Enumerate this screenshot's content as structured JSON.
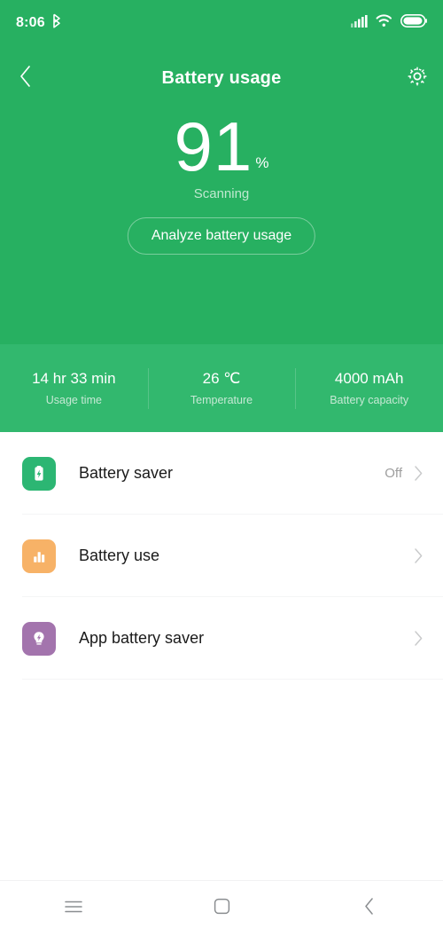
{
  "status_bar": {
    "time": "8:06",
    "icons": [
      "bluetooth-icon",
      "signal-icon",
      "wifi-icon",
      "battery-icon"
    ]
  },
  "header": {
    "title": "Battery usage",
    "back_icon": "chevron-left-icon",
    "settings_icon": "gear-icon"
  },
  "hero": {
    "percent": "91",
    "percent_symbol": "%",
    "status": "Scanning",
    "analyze_label": "Analyze battery usage",
    "bg_color": "#27b061"
  },
  "stats": {
    "bg_color": "#32b86e",
    "items": [
      {
        "value": "14 hr 33 min",
        "label": "Usage time"
      },
      {
        "value": "26 ℃",
        "label": "Temperature"
      },
      {
        "value": "4000 mAh",
        "label": "Battery capacity"
      }
    ]
  },
  "list": {
    "rows": [
      {
        "label": "Battery saver",
        "value": "Off",
        "icon": "battery-bolt-icon",
        "icon_color": "#2cb673",
        "chevron": "chevron-right-icon"
      },
      {
        "label": "Battery use",
        "value": "",
        "icon": "bar-chart-icon",
        "icon_color": "#f7b267",
        "chevron": "chevron-right-icon"
      },
      {
        "label": "App battery saver",
        "value": "",
        "icon": "lightbulb-bolt-icon",
        "icon_color": "#a374ad",
        "chevron": "chevron-right-icon"
      }
    ]
  },
  "navbar": {
    "buttons": [
      {
        "icon": "menu-icon"
      },
      {
        "icon": "home-square-icon"
      },
      {
        "icon": "back-chevron-icon"
      }
    ]
  }
}
